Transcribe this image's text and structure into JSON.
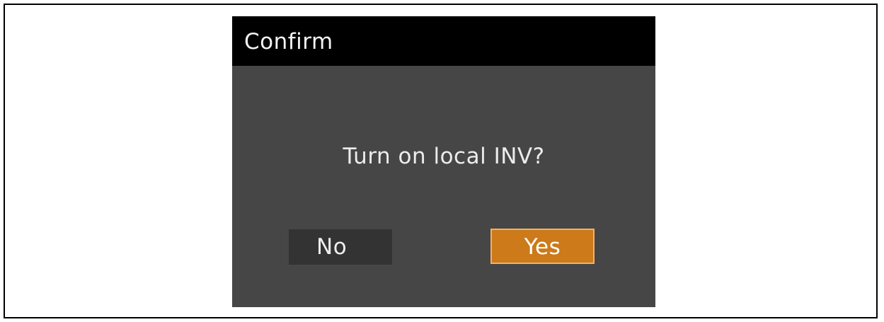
{
  "dialog": {
    "title": "Confirm",
    "message": "Turn on local INV?",
    "buttons": {
      "no_label": "No",
      "yes_label": "Yes"
    }
  },
  "colors": {
    "title_bar": "#000000",
    "dialog_body": "#464646",
    "no_button": "#333333",
    "yes_button": "#cc7a1a",
    "yes_button_border": "#f0b26a"
  }
}
